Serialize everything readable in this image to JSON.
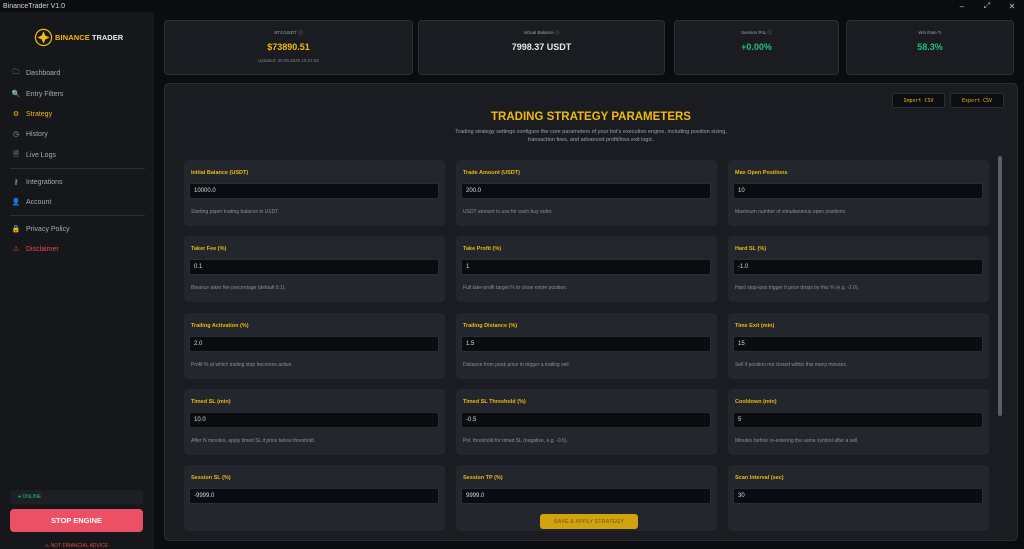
{
  "window": {
    "title": "BinanceTrader V1.0",
    "min": "–",
    "max": "⤢",
    "close": "✕"
  },
  "brand": {
    "part1": "BINANCE",
    "part2": "TRADER"
  },
  "nav": [
    {
      "label": "Dashboard",
      "icon": "folder-icon"
    },
    {
      "label": "Entry Filters",
      "icon": "filter-icon"
    },
    {
      "label": "Strategy",
      "icon": "gear-icon"
    },
    {
      "label": "History",
      "icon": "clock-icon"
    },
    {
      "label": "Live Logs",
      "icon": "log-icon"
    }
  ],
  "nav2": [
    {
      "label": "Integrations",
      "icon": "plug-icon"
    },
    {
      "label": "Account",
      "icon": "user-icon"
    }
  ],
  "nav3": [
    {
      "label": "Privacy Policy",
      "icon": "lock-icon"
    },
    {
      "label": "Disclaimer",
      "icon": "warning-icon"
    }
  ],
  "engine": {
    "status": "● ONLINE",
    "stop_label": "STOP ENGINE",
    "nfa": "⚠ NOT FINANCIAL ADVICE"
  },
  "stats": {
    "btc": {
      "label": "BTC/USDT",
      "value": "$73890.51",
      "updated": "Updated: 30.05.2026 10:24:08"
    },
    "balance": {
      "label": "Virtual Balance",
      "value": "7998.37 USDT"
    },
    "pnl": {
      "label": "Session PnL",
      "value": "+0.00%"
    },
    "winrate": {
      "label": "Win Rate",
      "value": "58.3%"
    }
  },
  "colors": {
    "accent": "#f0b90b",
    "positive": "#21c07a",
    "danger": "#ec5064"
  },
  "toolbar": {
    "import": "Import CSV",
    "export": "Export CSV"
  },
  "strategy": {
    "title": "TRADING STRATEGY PARAMETERS",
    "description": "Trading strategy settings configure the core parameters of your bot's execution engine, including position sizing, transaction fees, and advanced profit/loss exit logic.",
    "fields": [
      {
        "label": "Initial Balance (USDT)",
        "value": "10000.0",
        "desc": "Starting paper trading balance in USDT."
      },
      {
        "label": "Trade Amount (USDT)",
        "value": "200.0",
        "desc": "USDT amount to use for each buy order."
      },
      {
        "label": "Max Open Positions",
        "value": "10",
        "desc": "Maximum number of simultaneous open positions."
      },
      {
        "label": "Taker Fee (%)",
        "value": "0.1",
        "desc": "Binance taker fee percentage (default 0.1)."
      },
      {
        "label": "Take Profit (%)",
        "value": "1",
        "desc": "Full take-profit target % to close entire position."
      },
      {
        "label": "Hard SL (%)",
        "value": "-1.0",
        "desc": "Hard stop-loss trigger if price drops by this % (e.g. -2.0)."
      },
      {
        "label": "Trailing Activation (%)",
        "value": "2.0",
        "desc": "Profit % at which trailing stop becomes active."
      },
      {
        "label": "Trailing Distance (%)",
        "value": "1.5",
        "desc": "Distance from peak price to trigger a trailing sell."
      },
      {
        "label": "Time Exit (min)",
        "value": "15",
        "desc": "Sell if position not closed within this many minutes."
      },
      {
        "label": "Timed SL (min)",
        "value": "10.0",
        "desc": "After N minutes, apply timed SL if price below threshold."
      },
      {
        "label": "Timed SL Threshold (%)",
        "value": "-0.5",
        "desc": "Pnl. threshold for timed SL (negative, e.g. -0.5)."
      },
      {
        "label": "Cooldown (min)",
        "value": "5",
        "desc": "Minutes before re-entering the same symbol after a sell."
      },
      {
        "label": "Session SL (%)",
        "value": "-9999.0",
        "desc": ""
      },
      {
        "label": "Session TP (%)",
        "value": "9999.0",
        "desc": ""
      },
      {
        "label": "Scan Interval (sec)",
        "value": "30",
        "desc": ""
      }
    ],
    "save_label": "SAVE & APPLY STRATEGY"
  }
}
